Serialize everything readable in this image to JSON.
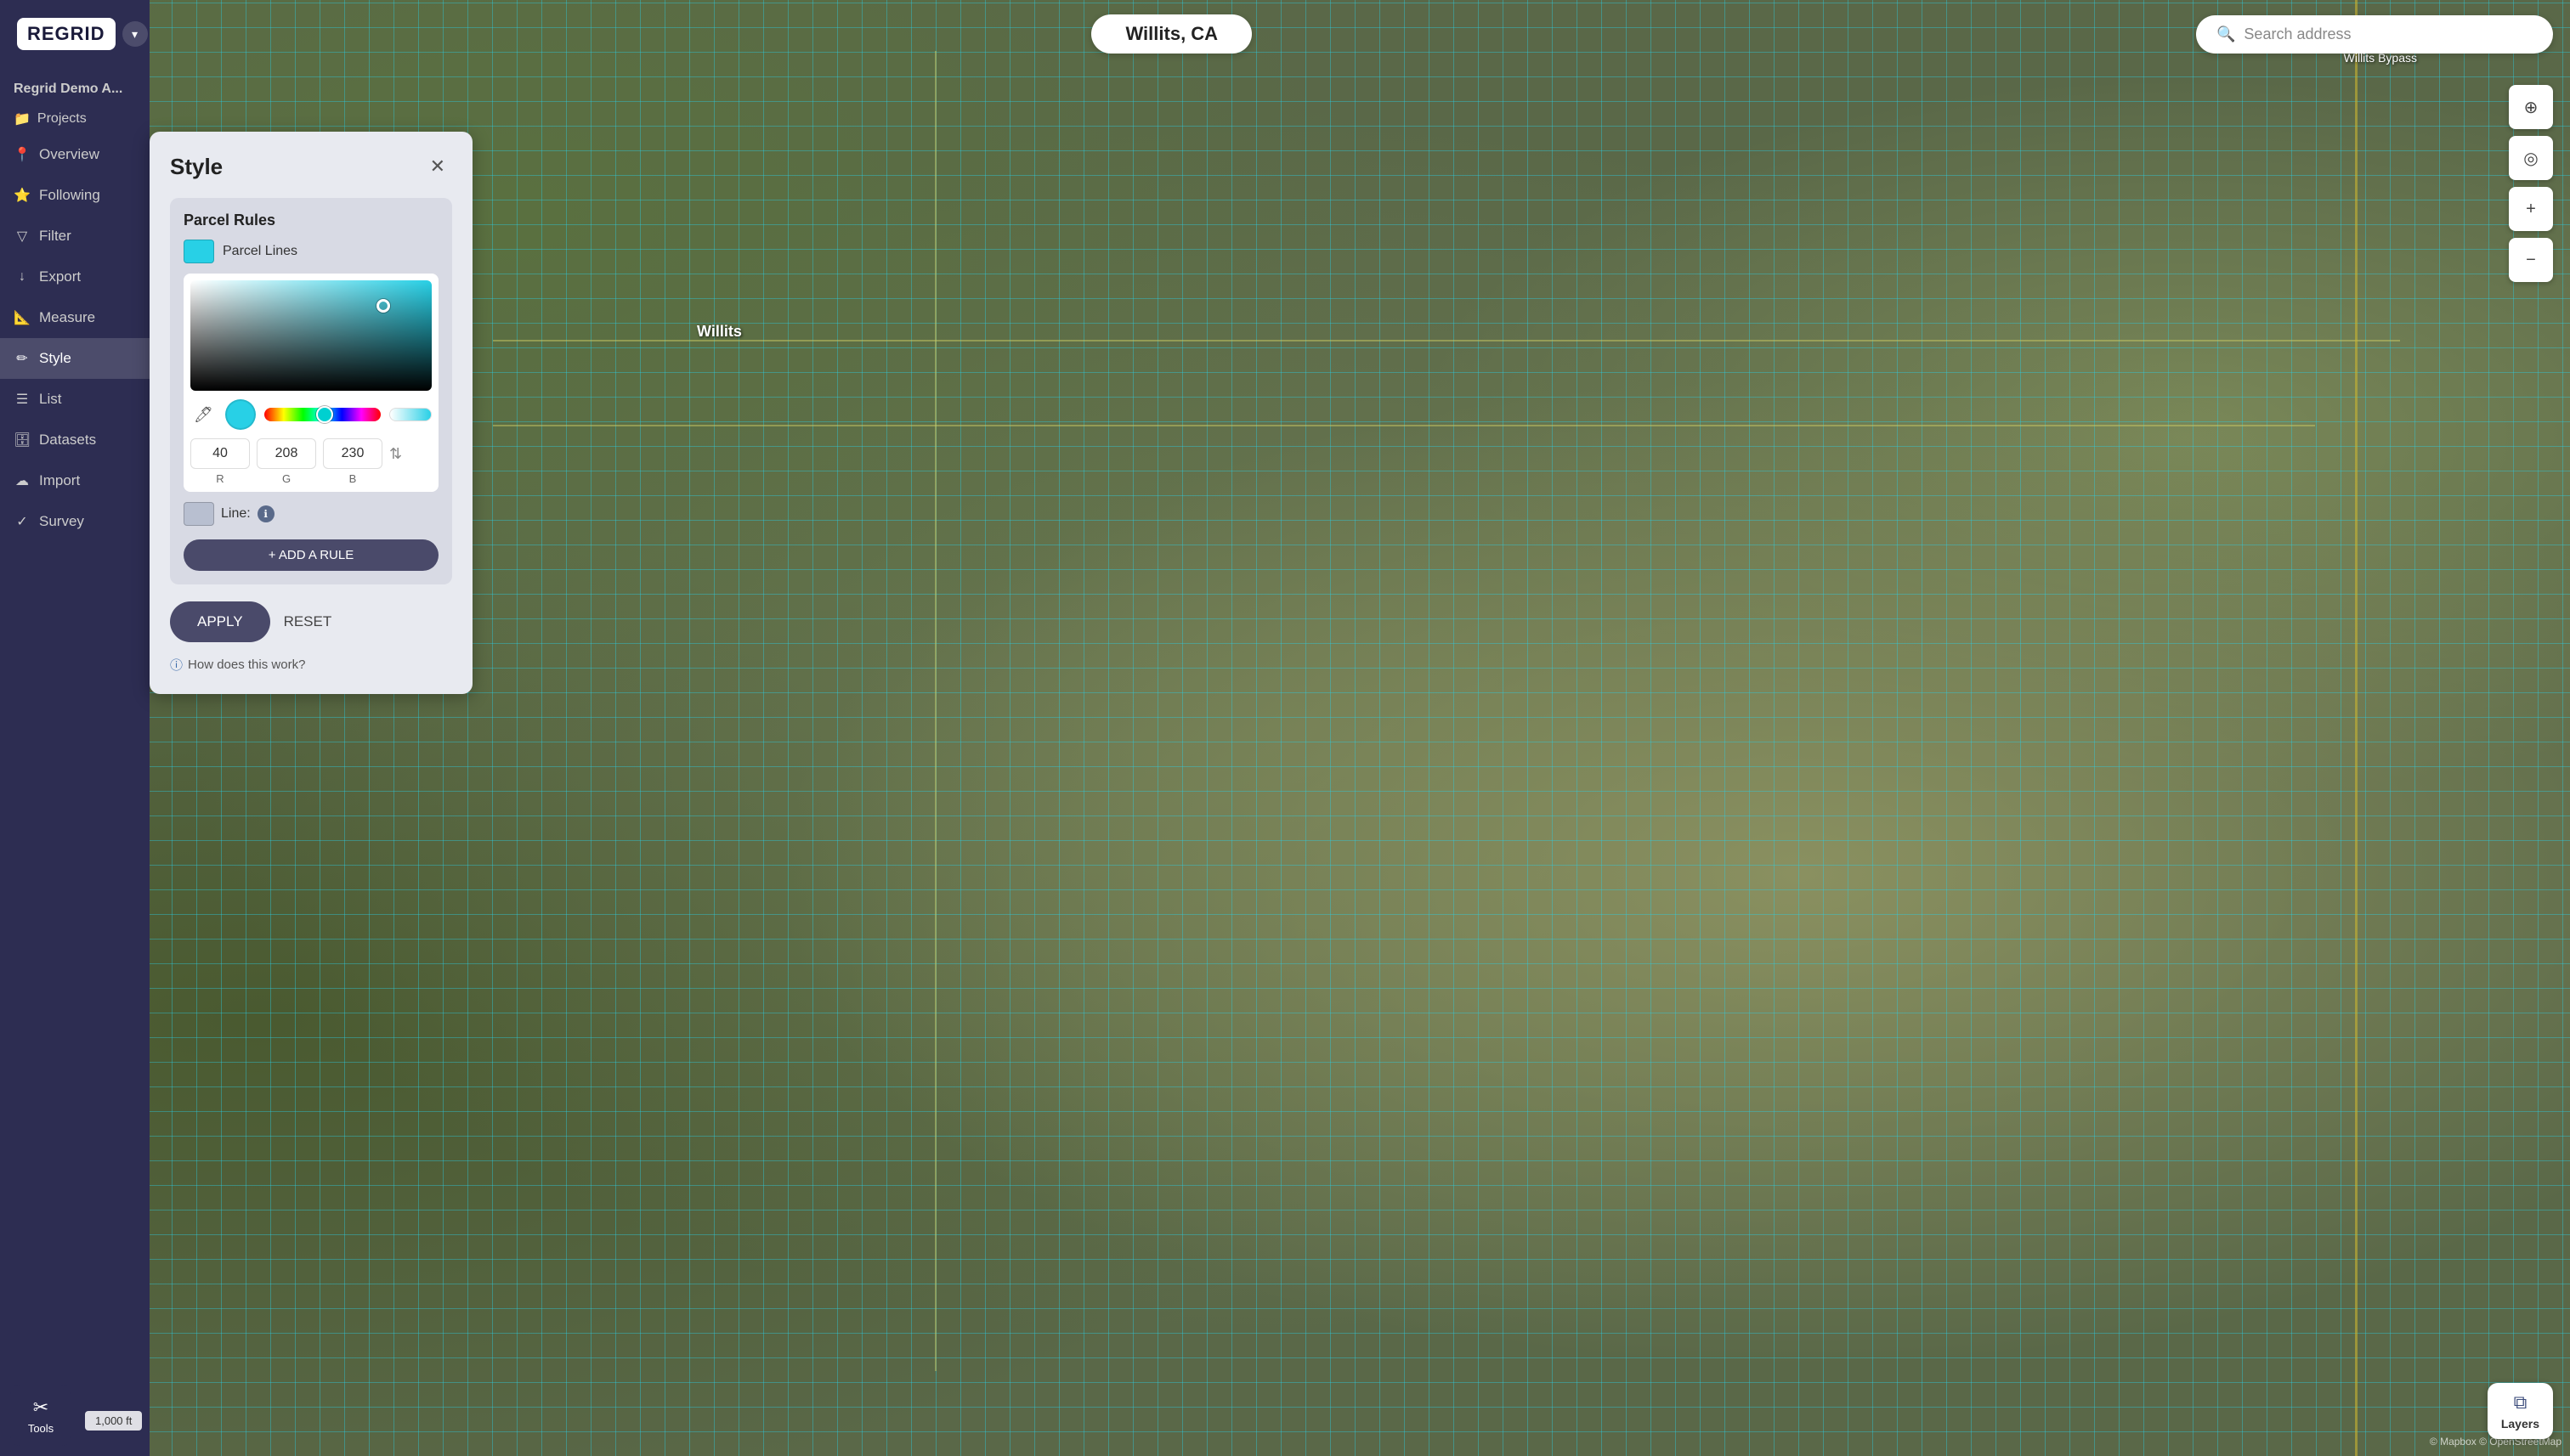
{
  "app": {
    "logo": "REGRID",
    "logo_dropdown_icon": "▾",
    "city_label": "Willits, CA",
    "search_placeholder": "Search address"
  },
  "sidebar": {
    "title": "Regrid Demo A...",
    "projects_label": "Projects",
    "items": [
      {
        "id": "overview",
        "label": "Overview",
        "icon": "📍"
      },
      {
        "id": "following",
        "label": "Following",
        "icon": "⭐"
      },
      {
        "id": "filter",
        "label": "Filter",
        "icon": "🔻"
      },
      {
        "id": "export",
        "label": "Export",
        "icon": "⬇"
      },
      {
        "id": "measure",
        "label": "Measure",
        "icon": "📏"
      },
      {
        "id": "style",
        "label": "Style",
        "icon": "✏"
      },
      {
        "id": "list",
        "label": "List",
        "icon": "≡"
      },
      {
        "id": "datasets",
        "label": "Datasets",
        "icon": "🗄"
      },
      {
        "id": "import",
        "label": "Import",
        "icon": "☁"
      },
      {
        "id": "survey",
        "label": "Survey",
        "icon": "✓"
      }
    ]
  },
  "style_panel": {
    "title": "Style",
    "close_icon": "✕",
    "parcel_rules_title": "Parcel Rules",
    "parcel_lines_label": "Parcel Lines",
    "color": {
      "r": 40,
      "g": 208,
      "b": 230
    },
    "rgb_labels": {
      "r": "R",
      "g": "G",
      "b": "B"
    },
    "line_label": "Line:",
    "add_rule_label": "+ ADD A RULE",
    "apply_label": "APPLY",
    "reset_label": "RESET",
    "help_text": "How does this work?"
  },
  "map": {
    "willits_label": "Willits",
    "attribution": "© Mapbox",
    "attribution2": "© Mapbox  © OpenStreetMap"
  },
  "layers_btn": {
    "icon": "⧉",
    "label": "Layers"
  },
  "tools_btn": {
    "icon": "✂",
    "label": "Tools"
  },
  "scale_bar": {
    "label": "1,000 ft"
  },
  "map_controls": {
    "compass_icon": "⊕",
    "location_icon": "◎",
    "zoom_in": "+",
    "zoom_out": "−"
  }
}
